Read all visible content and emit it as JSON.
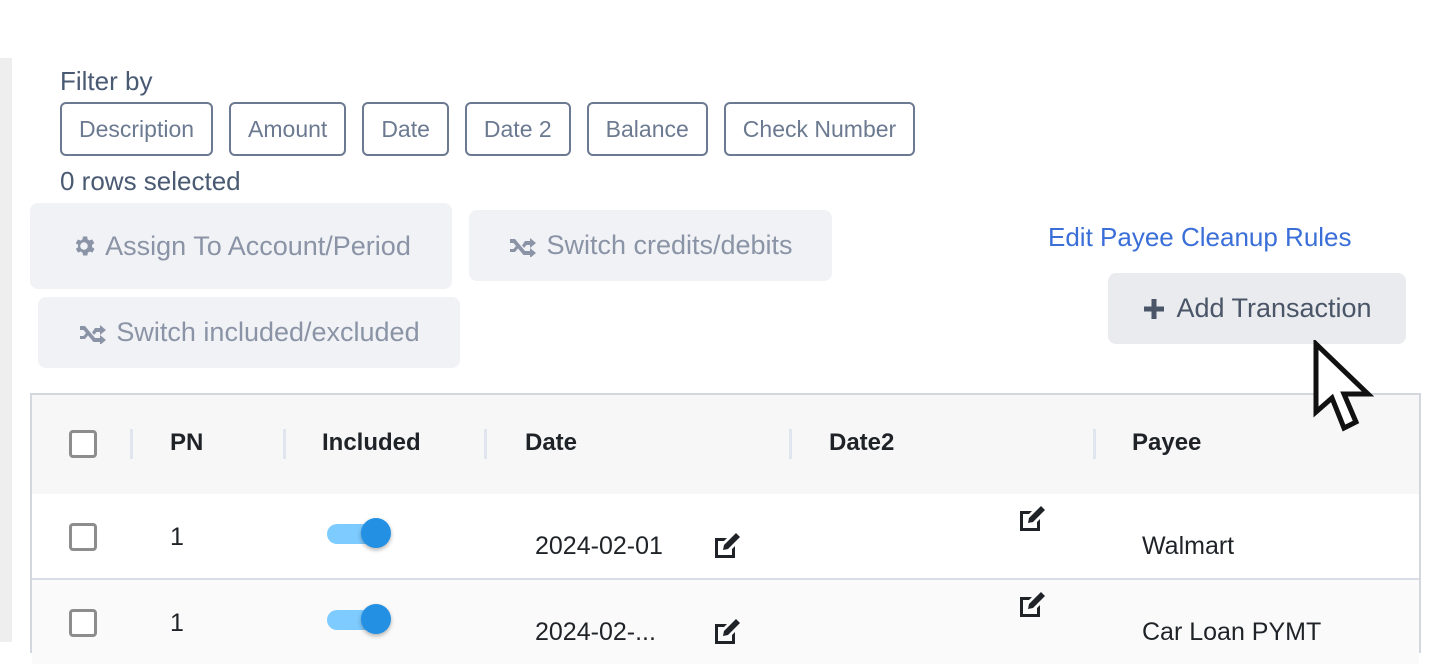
{
  "filter": {
    "label": "Filter by",
    "buttons": [
      "Description",
      "Amount",
      "Date",
      "Date 2",
      "Balance",
      "Check Number"
    ]
  },
  "selection": {
    "status": "0 rows selected"
  },
  "actions": {
    "assign": {
      "label": "Assign To Account/Period",
      "icon": "gear-icon"
    },
    "switch_credits_debits": {
      "label": "Switch credits/debits",
      "icon": "shuffle-icon"
    },
    "switch_included_excluded": {
      "label": "Switch included/excluded",
      "icon": "shuffle-icon"
    },
    "edit_payee_rules": "Edit Payee Cleanup Rules",
    "add_transaction": {
      "label": "Add Transaction",
      "icon": "plus-icon"
    }
  },
  "colors": {
    "link": "#3b6fd8",
    "toggle_on": "#2490e4",
    "toggle_track": "#7ecbff"
  },
  "table": {
    "columns": [
      "PN",
      "Included",
      "Date",
      "Date2",
      "Payee"
    ],
    "rows": [
      {
        "selected": false,
        "pn": "1",
        "included": true,
        "date": "2024-02-01",
        "date2": "",
        "payee": "Walmart"
      },
      {
        "selected": false,
        "pn": "1",
        "included": true,
        "date": "2024-02-...",
        "date2": "",
        "payee": "Car Loan PYMT"
      }
    ]
  }
}
